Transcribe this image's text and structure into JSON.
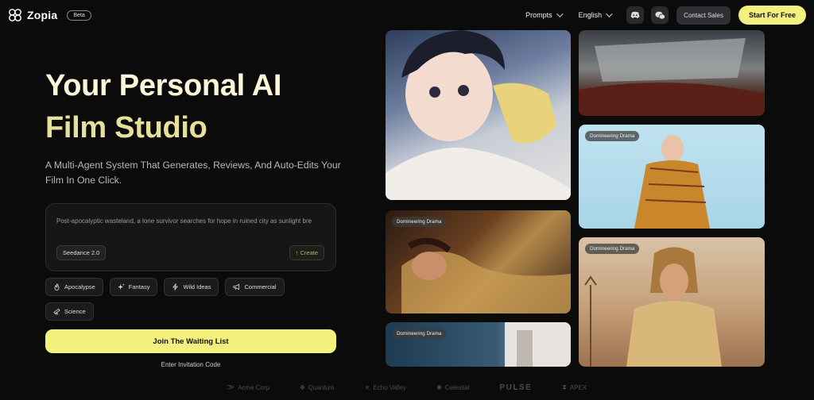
{
  "header": {
    "logo_text": "Zopia",
    "beta": "Beta",
    "nav_prompts": "Prompts",
    "nav_language": "English",
    "contact": "Contact Sales",
    "start": "Start For Free"
  },
  "hero": {
    "title_line1": "Your Personal AI",
    "title_line2": "Film Studio",
    "subtitle": "A Multi-Agent System That Generates, Reviews, And Auto-Edits Your Film In One Click."
  },
  "prompt": {
    "text": "Post-apocalyptic wasteland, a lone survivor searches for hope in ruined city as sunlight bre",
    "model": "Seedance 2.0",
    "create": "Create"
  },
  "tags": [
    {
      "label": "Apocalypse",
      "icon": "flame-icon"
    },
    {
      "label": "Fantasy",
      "icon": "sparkle-icon"
    },
    {
      "label": "Wild Ideas",
      "icon": "bolt-icon"
    },
    {
      "label": "Commercial",
      "icon": "megaphone-icon"
    },
    {
      "label": "Science",
      "icon": "telescope-icon"
    }
  ],
  "cta": {
    "join": "Join The Waiting List",
    "invite": "Enter Invitation Code"
  },
  "gallery": {
    "badge_label": "Domineering Drama"
  },
  "brands": [
    "Acme Corp",
    "Quantum",
    "Echo Valley",
    "Celestial",
    "PULSE",
    "APEX"
  ]
}
